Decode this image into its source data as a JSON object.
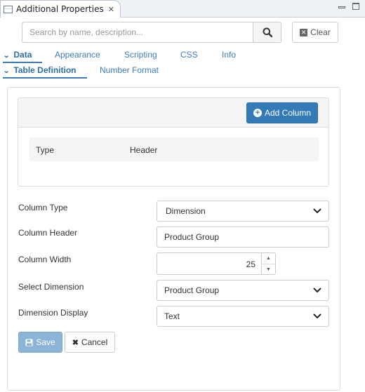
{
  "view": {
    "title": "Additional Properties",
    "close_glyph": "✕"
  },
  "search": {
    "placeholder": "Search by name, description...",
    "value": "",
    "clear_label": "Clear"
  },
  "main_tabs": [
    {
      "label": "Data",
      "active": true
    },
    {
      "label": "Appearance",
      "active": false
    },
    {
      "label": "Scripting",
      "active": false
    },
    {
      "label": "CSS",
      "active": false
    },
    {
      "label": "Info",
      "active": false
    }
  ],
  "sub_tabs": [
    {
      "label": "Table Definition",
      "active": true
    },
    {
      "label": "Number Format",
      "active": false
    }
  ],
  "columns_grid": {
    "add_label": "Add Column",
    "headers": [
      "Type",
      "Header"
    ]
  },
  "form": {
    "column_type": {
      "label": "Column Type",
      "value": "Dimension"
    },
    "column_header": {
      "label": "Column Header",
      "value": "Product Group"
    },
    "column_width": {
      "label": "Column Width",
      "value": "25"
    },
    "select_dimension": {
      "label": "Select Dimension",
      "value": "Product Group"
    },
    "dimension_display": {
      "label": "Dimension Display",
      "value": "Text"
    }
  },
  "actions": {
    "save_label": "Save",
    "cancel_label": "Cancel"
  },
  "colors": {
    "primary": "#337ab7",
    "link": "#3b7cb8",
    "save_disabled": "#8db4d6"
  },
  "icons": [
    "view-icon",
    "close-icon",
    "minimize-icon",
    "maximize-icon",
    "search-icon",
    "clear-icon",
    "chevron-down-icon",
    "plus-circle-icon",
    "caret-down-icon",
    "spinner-up-icon",
    "spinner-down-icon",
    "save-icon",
    "times-icon"
  ]
}
